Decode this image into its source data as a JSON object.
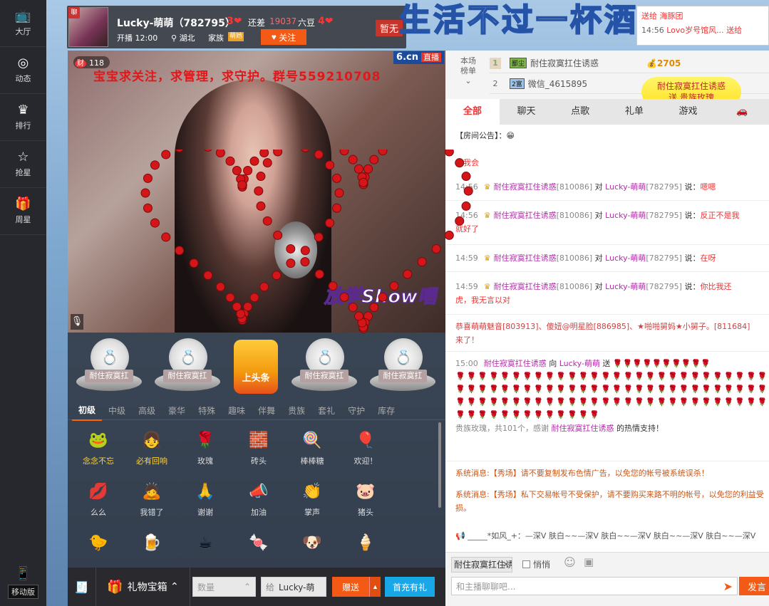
{
  "sidebar": {
    "items": [
      {
        "label": "大厅",
        "icon": "tv-icon"
      },
      {
        "label": "动态",
        "icon": "compass-icon"
      },
      {
        "label": "排行",
        "icon": "crown-icon"
      },
      {
        "label": "抢星",
        "icon": "star-icon"
      },
      {
        "label": "周星",
        "icon": "gift-icon"
      }
    ],
    "mobile_label": "移动版"
  },
  "anchor": {
    "avatar_badge": "聊",
    "name": "Lucky-萌萌（782795）",
    "level1": "3",
    "short_label": "还差",
    "short_value": "19037",
    "bean_label": "六豆",
    "level2": "4",
    "start_time": "开播 12:00",
    "location": "湖北",
    "family_label": "家族",
    "family_badge": "萌她",
    "follow_label": "关注",
    "ribbon": "暂无"
  },
  "overlay_title": "生活不过一杯酒",
  "top_ticker": {
    "line1": "送给 海豚团",
    "line2_time": "14:56",
    "line2_text": "Lovo岁号馆风... 送给"
  },
  "video": {
    "coin_icon": "财",
    "coin_count": "118",
    "banner": "宝宝求关注，求管理，求守护。群号559210708",
    "logo": "6.cn",
    "live_tag": "直播",
    "show_logo": "放学Show唱"
  },
  "gift_pedestals": [
    {
      "name": "耐住寂寞扛"
    },
    {
      "name": "耐住寂寞扛"
    },
    {
      "name": "耐住寂寞扛"
    },
    {
      "name": "耐住寂寞扛"
    }
  ],
  "headline_button": "上头条",
  "gift_tabs": [
    "初级",
    "中级",
    "高级",
    "豪华",
    "特殊",
    "趣味",
    "伴舞",
    "贵族",
    "套礼",
    "守护",
    "库存"
  ],
  "gifts": [
    {
      "name": "念念不忘",
      "icon": "🐸",
      "hot": true
    },
    {
      "name": "必有回响",
      "icon": "👧",
      "hot": true
    },
    {
      "name": "玫瑰",
      "icon": "🌹",
      "hot": false
    },
    {
      "name": "砖头",
      "icon": "🧱",
      "hot": false
    },
    {
      "name": "棒棒糖",
      "icon": "🍭",
      "hot": false
    },
    {
      "name": "欢迎！",
      "icon": "🎈",
      "hot": false
    },
    {
      "name": "么么",
      "icon": "💋",
      "hot": false
    },
    {
      "name": "我错了",
      "icon": "🙇",
      "hot": false
    },
    {
      "name": "谢谢",
      "icon": "🙏",
      "hot": false
    },
    {
      "name": "加油",
      "icon": "📣",
      "hot": false
    },
    {
      "name": "掌声",
      "icon": "👏",
      "hot": false
    },
    {
      "name": "猪头",
      "icon": "🐷",
      "hot": false
    },
    {
      "name": "",
      "icon": "🐤",
      "hot": false
    },
    {
      "name": "",
      "icon": "🍺",
      "hot": false
    },
    {
      "name": "",
      "icon": "☕",
      "hot": false
    },
    {
      "name": "",
      "icon": "🍬",
      "hot": false
    },
    {
      "name": "",
      "icon": "🐶",
      "hot": false
    },
    {
      "name": "",
      "icon": "🍦",
      "hot": false
    }
  ],
  "bottombar": {
    "giftbox_label": "礼物宝箱",
    "qty_placeholder": "数量",
    "to_label": "给",
    "to_value": "Lucky-萌",
    "send_label": "赠送",
    "recharge_label": "首充有礼"
  },
  "rank": {
    "label": "本场榜单",
    "rows": [
      {
        "no": "1",
        "badge": "鄙尘",
        "name": "耐住寂寞扛住诱惑",
        "value": "2705"
      },
      {
        "no": "2",
        "badge": "2富",
        "name": "微信_4615895",
        "value": ""
      }
    ]
  },
  "notify": {
    "line1": "耐住寂寞扛住诱惑",
    "line2": "送 贵族玫瑰"
  },
  "chat_tabs": [
    "全部",
    "聊天",
    "点歌",
    "礼单",
    "游戏"
  ],
  "chat": {
    "announcement": "【房间公告】：",
    "first_line": "你我会",
    "messages": [
      {
        "time": "14:56",
        "user": "耐住寂寞扛住诱惑",
        "uid": "[810086]",
        "to": "对",
        "target": "Lucky-萌萌",
        "tid": "[782795]",
        "said": "说：",
        "text": "嗯嗯",
        "cont": ""
      },
      {
        "time": "14:56",
        "user": "耐住寂寞扛住诱惑",
        "uid": "[810086]",
        "to": "对",
        "target": "Lucky-萌萌",
        "tid": "[782795]",
        "said": "说：",
        "text": "反正不是我",
        "cont": "就好了"
      },
      {
        "time": "14:59",
        "user": "耐住寂寞扛住诱惑",
        "uid": "[810086]",
        "to": "对",
        "target": "Lucky-萌萌",
        "tid": "[782795]",
        "said": "说：",
        "text": "在呀",
        "cont": ""
      },
      {
        "time": "14:59",
        "user": "耐住寂寞扛住诱惑",
        "uid": "[810086]",
        "to": "对",
        "target": "Lucky-萌萌",
        "tid": "[782795]",
        "said": "说：",
        "text": "你比我还",
        "cont": "虎，我无言以对"
      }
    ],
    "welcome": "恭喜萌萌魅音[803913]、傻妞@明星脸[886985]、★啪啪舅妈★小舅子。[811684]",
    "welcome_cont": "来了！",
    "gift_msg": {
      "time": "15:00",
      "user": "耐住寂寞扛住诱惑",
      "to": "向",
      "target": "Lucky-萌萌",
      "verb": "送",
      "summary": "贵族玫瑰，共101个，感谢",
      "thanks_user": "耐住寂寞扛住诱惑",
      "thanks_tail": "的热情支持！"
    },
    "sys1_tag": "系统消息:",
    "sys1": "【秀场】请不要复制发布色情广告，以免您的帐号被系统误杀！",
    "sys2_tag": "系统消息:",
    "sys2": "【秀场】私下交易帐号不受保护，请不要购买来路不明的帐号，以免您的利益受损。",
    "scroll_line": "_____*如风_+：—深V 肤白~~—深V 肤白~~—深V 肤白~~—深V 肤白~~—深V"
  },
  "chat_footer": {
    "target": "耐住寂寞扛住诱惑",
    "whisper": "悄悄",
    "input_placeholder": "和主播聊聊吧...",
    "send_label": "发言"
  }
}
